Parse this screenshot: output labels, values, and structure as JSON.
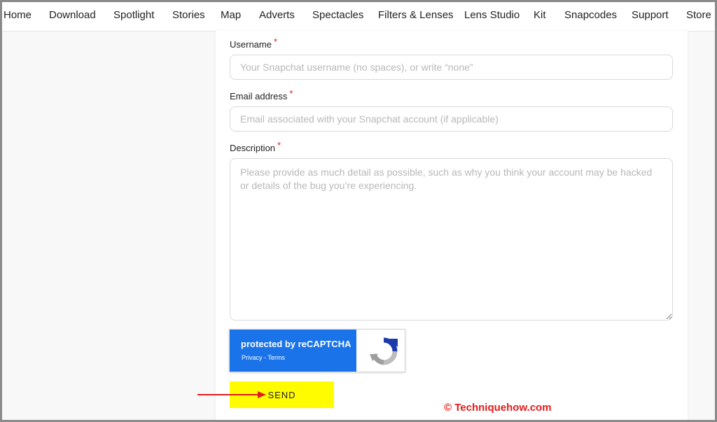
{
  "nav": {
    "items": [
      "Home",
      "Download",
      "Spotlight",
      "Stories",
      "Map",
      "Adverts",
      "Spectacles",
      "Filters & Lenses",
      "Lens Studio",
      "Kit",
      "Snapcodes",
      "Support",
      "Store"
    ]
  },
  "form": {
    "username": {
      "label": "Username",
      "required": "*",
      "placeholder": "Your Snapchat username (no spaces), or write “none”"
    },
    "email": {
      "label": "Email address",
      "required": "*",
      "placeholder": "Email associated with your Snapchat account (if applicable)"
    },
    "description": {
      "label": "Description",
      "required": "*",
      "placeholder": "Please provide as much detail as possible, such as why you think your account may be hacked or details of the bug you’re experiencing."
    },
    "send_label": "SEND"
  },
  "recaptcha": {
    "title": "protected by reCAPTCHA",
    "privacy": "Privacy",
    "separator": " - ",
    "terms": "Terms",
    "icon": "recaptcha-logo"
  },
  "annotation": {
    "watermark": "© Techniquehow.com",
    "arrow_color": "#e21b1b"
  },
  "colors": {
    "send_button": "#fffc00",
    "recaptcha_blue": "#1a73e8",
    "required_marker": "#e0201b"
  }
}
